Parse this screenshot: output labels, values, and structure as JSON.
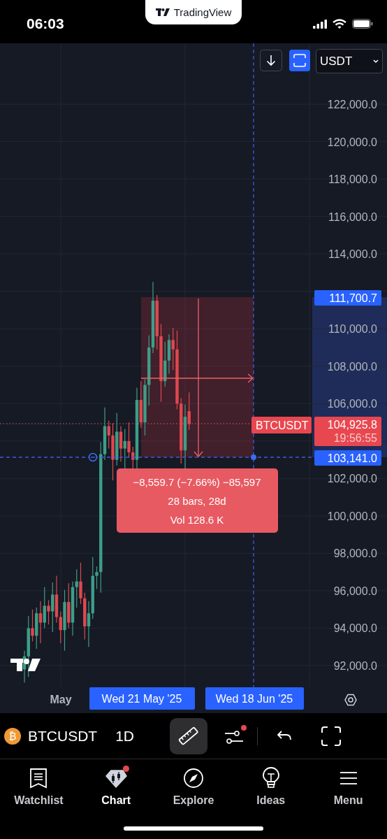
{
  "status_bar": {
    "time": "06:03"
  },
  "banner": {
    "label": "TradingView"
  },
  "chart": {
    "currency": "USDT",
    "price_scale": [
      "122,000.0",
      "120,000.0",
      "118,000.0",
      "116,000.0",
      "114,000.0",
      "110,000.0",
      "108,000.0",
      "106,000.0",
      "102,000.0",
      "100,000.0",
      "98,000.0",
      "96,000.0",
      "94,000.0",
      "92,000.0"
    ],
    "time_scale": [
      "May"
    ],
    "range_high": "111,700.7",
    "symbol_label": "BTCUSDT",
    "last_price": "104,925.8",
    "countdown": "19:56:55",
    "range_low": "103,141.0",
    "measure": {
      "change": "−8,559.7 (−7.66%) −85,597",
      "span": "28 bars, 28d",
      "volume": "Vol 128.6 K"
    },
    "crosshair_dates": [
      "Wed 21 May '25",
      "Wed 18 Jun '25"
    ]
  },
  "toolbar": {
    "coin_glyph": "₿",
    "symbol": "BTCUSDT",
    "interval": "1D",
    "ruler_active": true,
    "settings_dot": true
  },
  "nav": [
    {
      "kind": "watchlist",
      "label": "Watchlist",
      "selected": false,
      "dot": false
    },
    {
      "kind": "chart",
      "label": "Chart",
      "selected": true,
      "dot": true
    },
    {
      "kind": "explore",
      "label": "Explore",
      "selected": false,
      "dot": false
    },
    {
      "kind": "ideas",
      "label": "Ideas",
      "selected": false,
      "dot": false
    },
    {
      "kind": "menu",
      "label": "Menu",
      "selected": false,
      "dot": false
    }
  ]
}
